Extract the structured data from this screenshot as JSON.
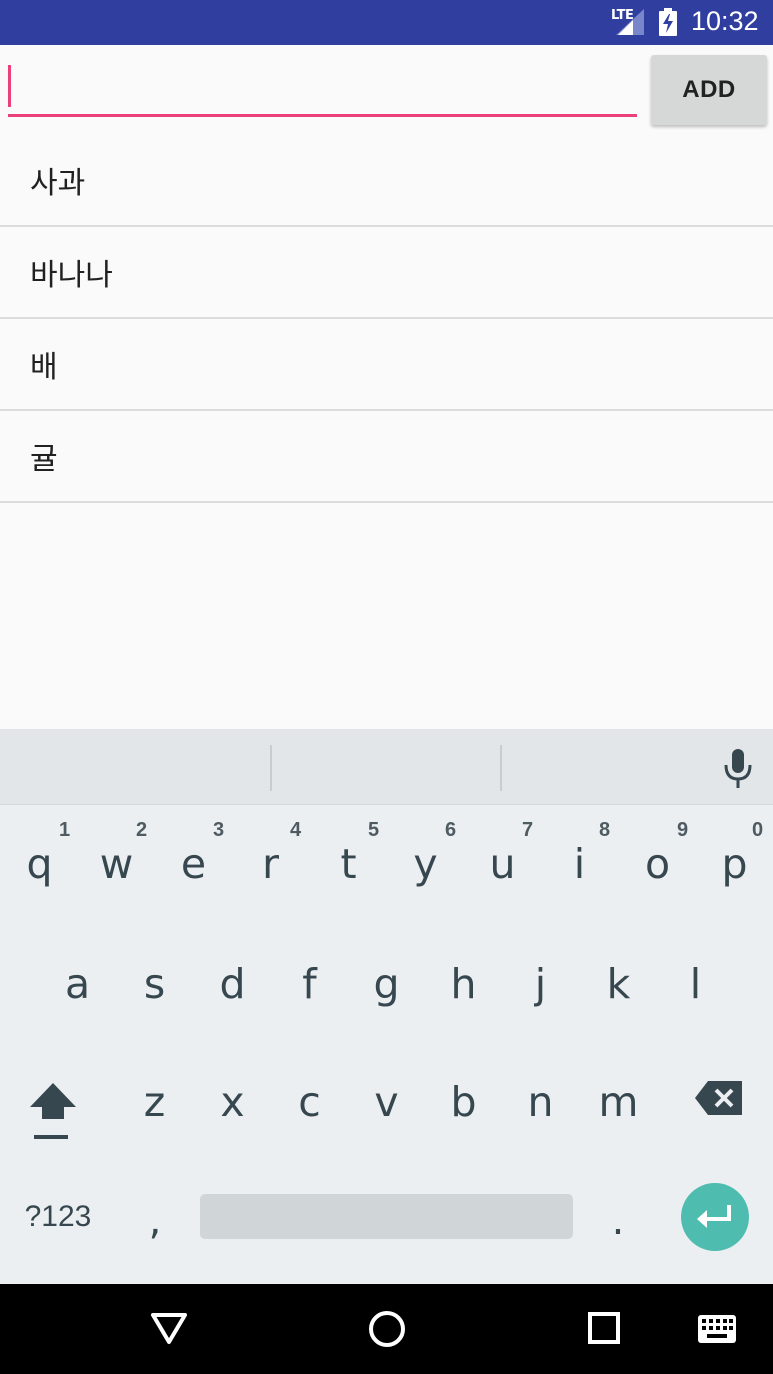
{
  "status_bar": {
    "network": "LTE",
    "time": "10:32"
  },
  "input": {
    "value": "",
    "placeholder": ""
  },
  "add_button": {
    "label": "ADD"
  },
  "list": {
    "items": [
      "사과",
      "바나나",
      "배",
      "귤"
    ]
  },
  "keyboard": {
    "row1": [
      {
        "key": "q",
        "hint": "1"
      },
      {
        "key": "w",
        "hint": "2"
      },
      {
        "key": "e",
        "hint": "3"
      },
      {
        "key": "r",
        "hint": "4"
      },
      {
        "key": "t",
        "hint": "5"
      },
      {
        "key": "y",
        "hint": "6"
      },
      {
        "key": "u",
        "hint": "7"
      },
      {
        "key": "i",
        "hint": "8"
      },
      {
        "key": "o",
        "hint": "9"
      },
      {
        "key": "p",
        "hint": "0"
      }
    ],
    "row2": [
      "a",
      "s",
      "d",
      "f",
      "g",
      "h",
      "j",
      "k",
      "l"
    ],
    "row3": [
      "z",
      "x",
      "c",
      "v",
      "b",
      "n",
      "m"
    ],
    "symbols_label": "?123",
    "comma": ",",
    "period": ".",
    "icons": {
      "shift": "shift-icon",
      "backspace": "backspace-icon",
      "enter": "enter-icon",
      "mic": "microphone-icon"
    },
    "colors": {
      "enter_bg": "#4ebcaf",
      "accent": "#ec407a",
      "status_bar": "#303f9f"
    }
  },
  "nav_bar": {
    "icons": [
      "back-icon",
      "home-icon",
      "recents-icon",
      "keyboard-icon"
    ]
  }
}
